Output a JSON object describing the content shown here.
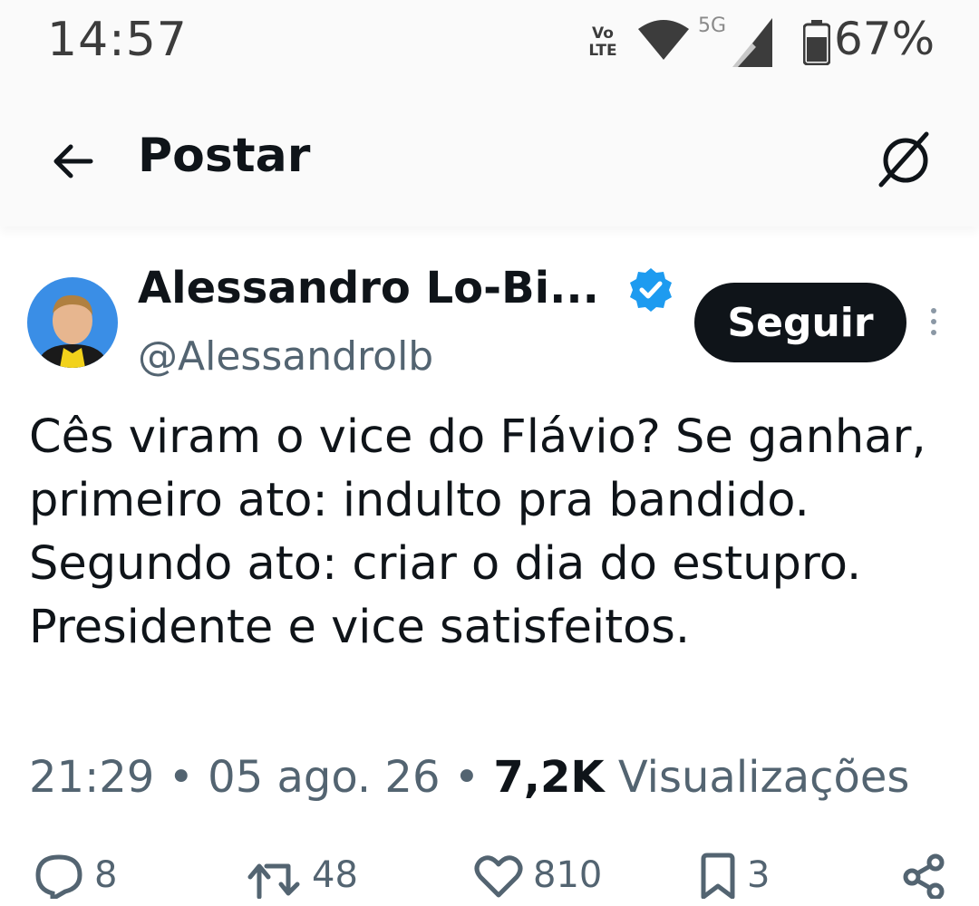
{
  "status_bar": {
    "time": "14:57",
    "volte_line1": "Vo",
    "volte_line2": "LTE",
    "network": "5G",
    "battery": "67%"
  },
  "top_bar": {
    "title": "Postar"
  },
  "post": {
    "author_name": "Alessandro Lo-Bi...",
    "author_handle": "@Alessandrolb",
    "follow_label": "Seguir",
    "text": "Cês viram o vice do Flávio? Se ganhar, primeiro ato: indulto pra bandido. Segundo ato: criar o dia do estupro. Presidente e vice satisfeitos.",
    "time": "21:29",
    "date": "05 ago. 26",
    "views_count": "7,2K",
    "views_label": "Visualizações",
    "separator": "•"
  },
  "actions": {
    "replies": "8",
    "reposts": "48",
    "likes": "810",
    "bookmarks": "3"
  },
  "colors": {
    "accent": "#1d9bf0",
    "text": "#0f1419",
    "secondary": "#536471",
    "button_bg": "#0f1419"
  },
  "icons": [
    "back-arrow-icon",
    "grok-icon",
    "verified-badge-icon",
    "more-icon",
    "reply-icon",
    "repost-icon",
    "like-icon",
    "bookmark-icon",
    "share-icon",
    "wifi-icon",
    "signal-icon",
    "battery-icon"
  ]
}
